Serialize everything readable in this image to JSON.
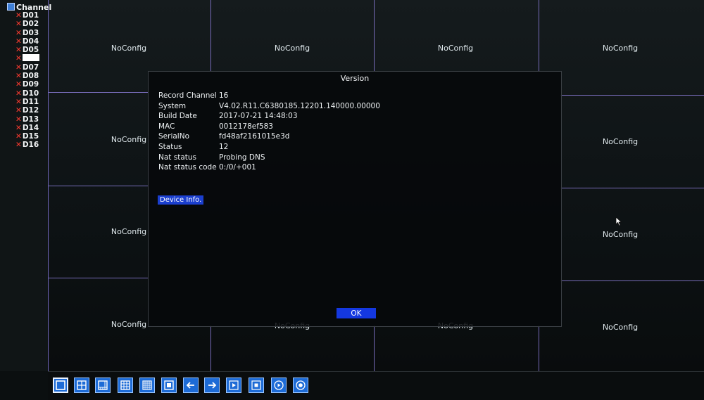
{
  "sidebar": {
    "title": "Channel",
    "channels": [
      {
        "label": "D01",
        "selected": false
      },
      {
        "label": "D02",
        "selected": false
      },
      {
        "label": "D03",
        "selected": false
      },
      {
        "label": "D04",
        "selected": false
      },
      {
        "label": "D05",
        "selected": false
      },
      {
        "label": "",
        "selected": true
      },
      {
        "label": "D07",
        "selected": false
      },
      {
        "label": "D08",
        "selected": false
      },
      {
        "label": "D09",
        "selected": false
      },
      {
        "label": "D10",
        "selected": false
      },
      {
        "label": "D11",
        "selected": false
      },
      {
        "label": "D12",
        "selected": false
      },
      {
        "label": "D13",
        "selected": false
      },
      {
        "label": "D14",
        "selected": false
      },
      {
        "label": "D15",
        "selected": false
      },
      {
        "label": "D16",
        "selected": false
      }
    ],
    "error_mark": "✕"
  },
  "grid": {
    "cell_text": "NoConfig",
    "labels": [
      "NoConfig",
      "NoConfig",
      "NoConfig",
      "NoConfig",
      "NoConfig",
      "NoConfig",
      "NoConfig",
      "NoConfig",
      "NoConfig",
      "NoConfig",
      "NoConfig",
      "NoConfig",
      "NoConfig",
      "NoConfig"
    ]
  },
  "dialog": {
    "title": "Version",
    "rows": [
      {
        "key": "Record Channel",
        "value": "16"
      },
      {
        "key": "System",
        "value": "V4.02.R11.C6380185.12201.140000.00000"
      },
      {
        "key": "Build Date",
        "value": "2017-07-21 14:48:03"
      },
      {
        "key": "MAC",
        "value": "0012178ef583"
      },
      {
        "key": "SerialNo",
        "value": "fd48af2161015e3d"
      },
      {
        "key": "Status",
        "value": "12"
      },
      {
        "key": "Nat status",
        "value": "Probing DNS"
      },
      {
        "key": "Nat status code",
        "value": "0:/0/+001"
      }
    ],
    "device_info_label": "Device Info.",
    "ok_label": "OK"
  },
  "toolbar": {
    "buttons": [
      {
        "icon": "single-view-icon"
      },
      {
        "icon": "quad-view-icon"
      },
      {
        "icon": "eight-view-icon"
      },
      {
        "icon": "nine-view-icon"
      },
      {
        "icon": "sixteen-view-icon"
      },
      {
        "icon": "fullscreen-icon"
      },
      {
        "icon": "arrow-left-icon"
      },
      {
        "icon": "arrow-right-icon"
      },
      {
        "icon": "play-icon"
      },
      {
        "icon": "stop-icon"
      },
      {
        "icon": "record-play-icon"
      },
      {
        "icon": "record-icon"
      }
    ]
  },
  "colors": {
    "grid_line": "#8a7bd6",
    "button_blue": "#1d6bd6",
    "ok_blue": "#1438e0",
    "error_red": "#ff3b30"
  }
}
